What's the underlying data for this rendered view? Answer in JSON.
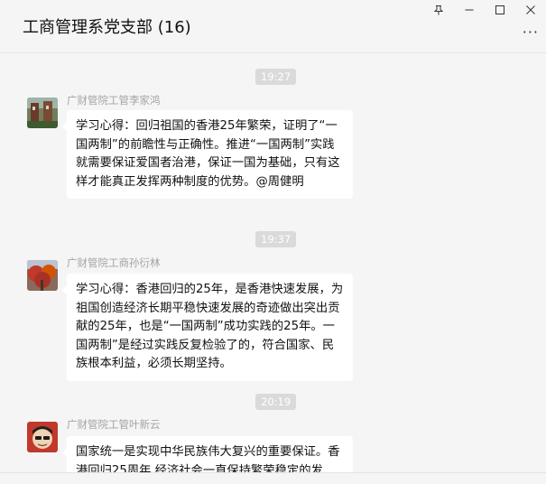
{
  "window": {
    "title": "工商管理系党支部 (16)",
    "controls": {
      "pin": "pin-icon",
      "minimize": "minimize-icon",
      "maximize": "maximize-icon",
      "close": "close-icon"
    },
    "more": "more-icon"
  },
  "messages": [
    {
      "time": "19:27",
      "sender": "广财管院工管李家鸿",
      "text": "学习心得：回归祖国的香港25年繁荣，证明了“一国两制”的前瞻性与正确性。推进“一国两制”实践就需要保证爱国者治港，保证一国为基础，只有这样才能真正发挥两种制度的优势。@周健明"
    },
    {
      "time": "19:37",
      "sender": "广财管院工商孙衍林",
      "text": "学习心得：香港回归的25年，是香港快速发展，为祖国创造经济长期平稳快速发展的奇迹做出突出贡献的25年，也是“一国两制”成功实践的25年。一国两制”是经过实践反复检验了的，符合国家、民族根本利益，必须长期坚持。"
    },
    {
      "time": "20:19",
      "sender": "广财管院工管叶新云",
      "text": "国家统一是实现中华民族伟大复兴的重要保证。香港回归25周年,经济社会一直保持繁荣稳定的发"
    }
  ],
  "colors": {
    "background": "#f5f5f5",
    "bubble": "#ffffff",
    "time_pill": "#dadada",
    "sender": "#a3a3a3"
  }
}
